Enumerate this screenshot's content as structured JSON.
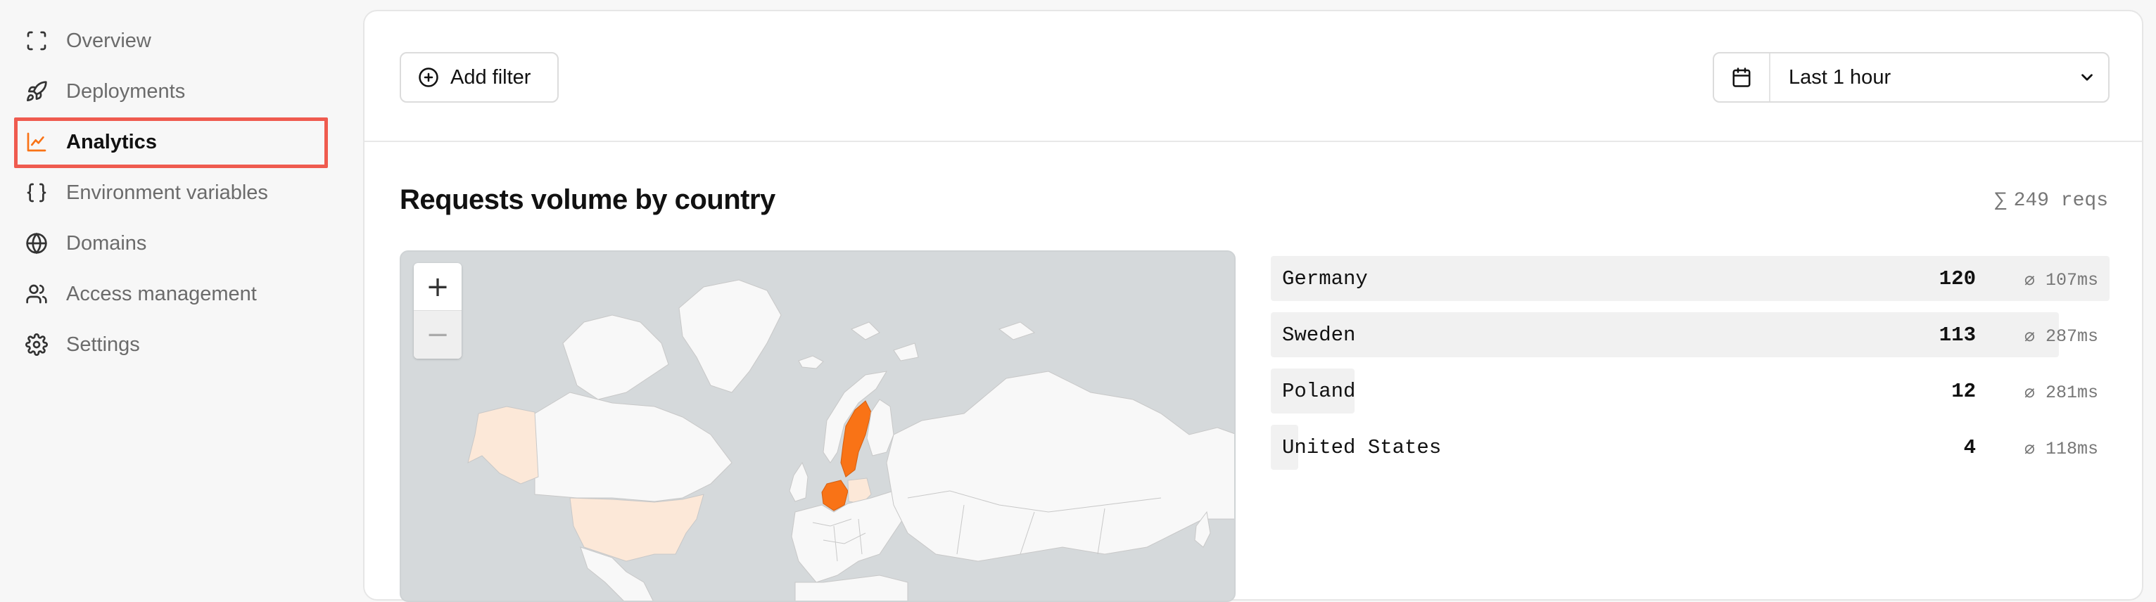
{
  "sidebar": {
    "items": [
      {
        "label": "Overview",
        "icon": "scan-icon"
      },
      {
        "label": "Deployments",
        "icon": "rocket-icon"
      },
      {
        "label": "Analytics",
        "icon": "chart-line-icon",
        "active": true
      },
      {
        "label": "Environment variables",
        "icon": "braces-icon"
      },
      {
        "label": "Domains",
        "icon": "globe-icon"
      },
      {
        "label": "Access management",
        "icon": "users-icon"
      },
      {
        "label": "Settings",
        "icon": "gear-icon"
      }
    ],
    "accent_color": "#f97316",
    "highlight_color": "#ef5b4f"
  },
  "toolbar": {
    "add_filter_label": "Add filter",
    "time_range": "Last 1 hour"
  },
  "section": {
    "title": "Requests volume by country",
    "total_symbol": "∑",
    "total_label": "249 reqs"
  },
  "map": {
    "zoom_in": "+",
    "zoom_out": "−",
    "highlight_color": "#f97316",
    "light_highlight_color": "#fce8d8"
  },
  "countries": [
    {
      "name": "Germany",
      "count": "120",
      "latency": "⌀ 107ms",
      "share": 1.0
    },
    {
      "name": "Sweden",
      "count": "113",
      "latency": "⌀ 287ms",
      "share": 0.94
    },
    {
      "name": "Poland",
      "count": "12",
      "latency": "⌀ 281ms",
      "share": 0.1
    },
    {
      "name": "United States",
      "count": "4",
      "latency": "⌀ 118ms",
      "share": 0.033
    }
  ]
}
